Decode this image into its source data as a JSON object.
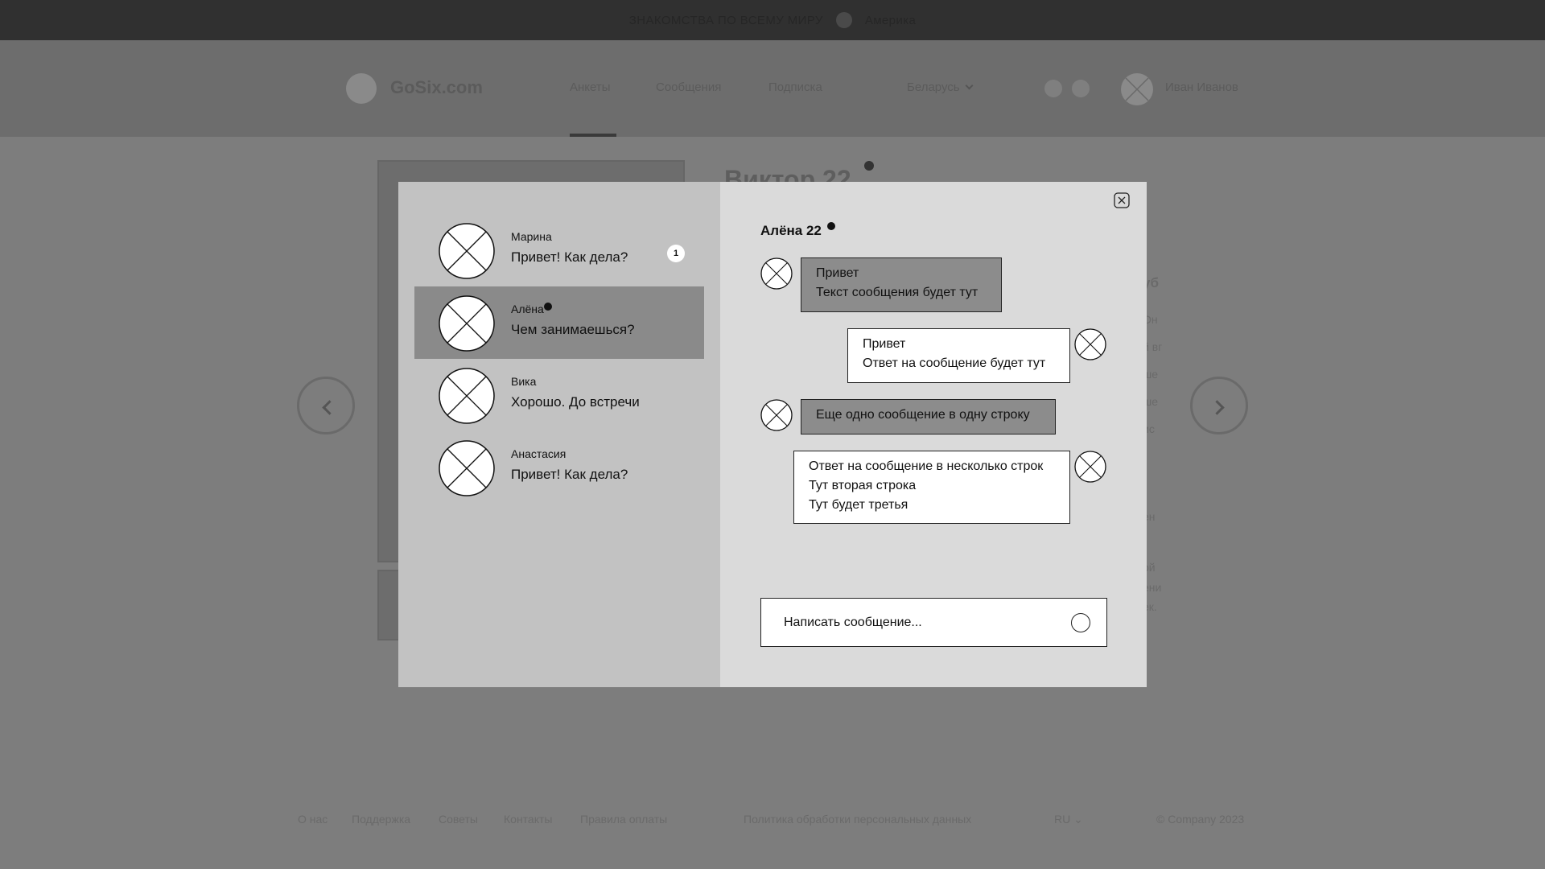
{
  "top_banner": {
    "text": "ЗНАКОМСТВА ПО ВСЕМУ МИРУ",
    "region": "Америка"
  },
  "header": {
    "logo": "GoSix.com",
    "nav": [
      "Анкеты",
      "Сообщения",
      "Подписка"
    ],
    "country": "Беларусь",
    "user_name": "Иван Иванов"
  },
  "profile": {
    "title": "Виктор 22"
  },
  "sidebar_labels": [
    "уб",
    "Он",
    "й вг",
    "ше",
    "ше",
    "ис",
    "ен",
    "ой",
    "ени",
    "ек."
  ],
  "footer": {
    "links": [
      "О нас",
      "Поддержка",
      "Советы",
      "Контакты",
      "Правила оплаты"
    ],
    "policy": "Политика обработки персональных данных",
    "language": "RU",
    "copyright": "© Company 2023"
  },
  "contacts": [
    {
      "name": "Марина",
      "last_message": "Привет! Как дела?",
      "unread": "1",
      "online": false,
      "active": false
    },
    {
      "name": "Алёна",
      "last_message": "Чем занимаешься?",
      "unread": "",
      "online": true,
      "active": true
    },
    {
      "name": "Вика",
      "last_message": "Хорошо. До встречи",
      "unread": "",
      "online": false,
      "active": false
    },
    {
      "name": "Анастасия",
      "last_message": "Привет! Как дела?",
      "unread": "",
      "online": false,
      "active": false
    }
  ],
  "chat": {
    "title": "Алёна 22",
    "messages": [
      {
        "direction": "in",
        "lines": [
          "Привет",
          "Текст сообщения будет тут"
        ]
      },
      {
        "direction": "out",
        "lines": [
          "Привет",
          "Ответ на сообщение будет тут"
        ]
      },
      {
        "direction": "in",
        "lines": [
          "Еще одно сообщение в одну строку"
        ]
      },
      {
        "direction": "out",
        "lines": [
          "Ответ на сообщение в несколько строк",
          "Тут вторая строка",
          "Тут будет третья"
        ]
      }
    ],
    "compose_placeholder": "Написать сообщение..."
  },
  "colors": {
    "active_contact": "#8a8a8a",
    "incoming_bubble": "#8c8c8c",
    "outgoing_bubble": "#ffffff",
    "left_pane": "#c2c2c2",
    "right_pane": "#dadada"
  },
  "icons": {
    "avatar_placeholder": "x-circle-icon",
    "close": "close-icon",
    "send": "send-icon",
    "arrow_prev": "chevron-left-icon",
    "arrow_next": "chevron-right-icon"
  }
}
